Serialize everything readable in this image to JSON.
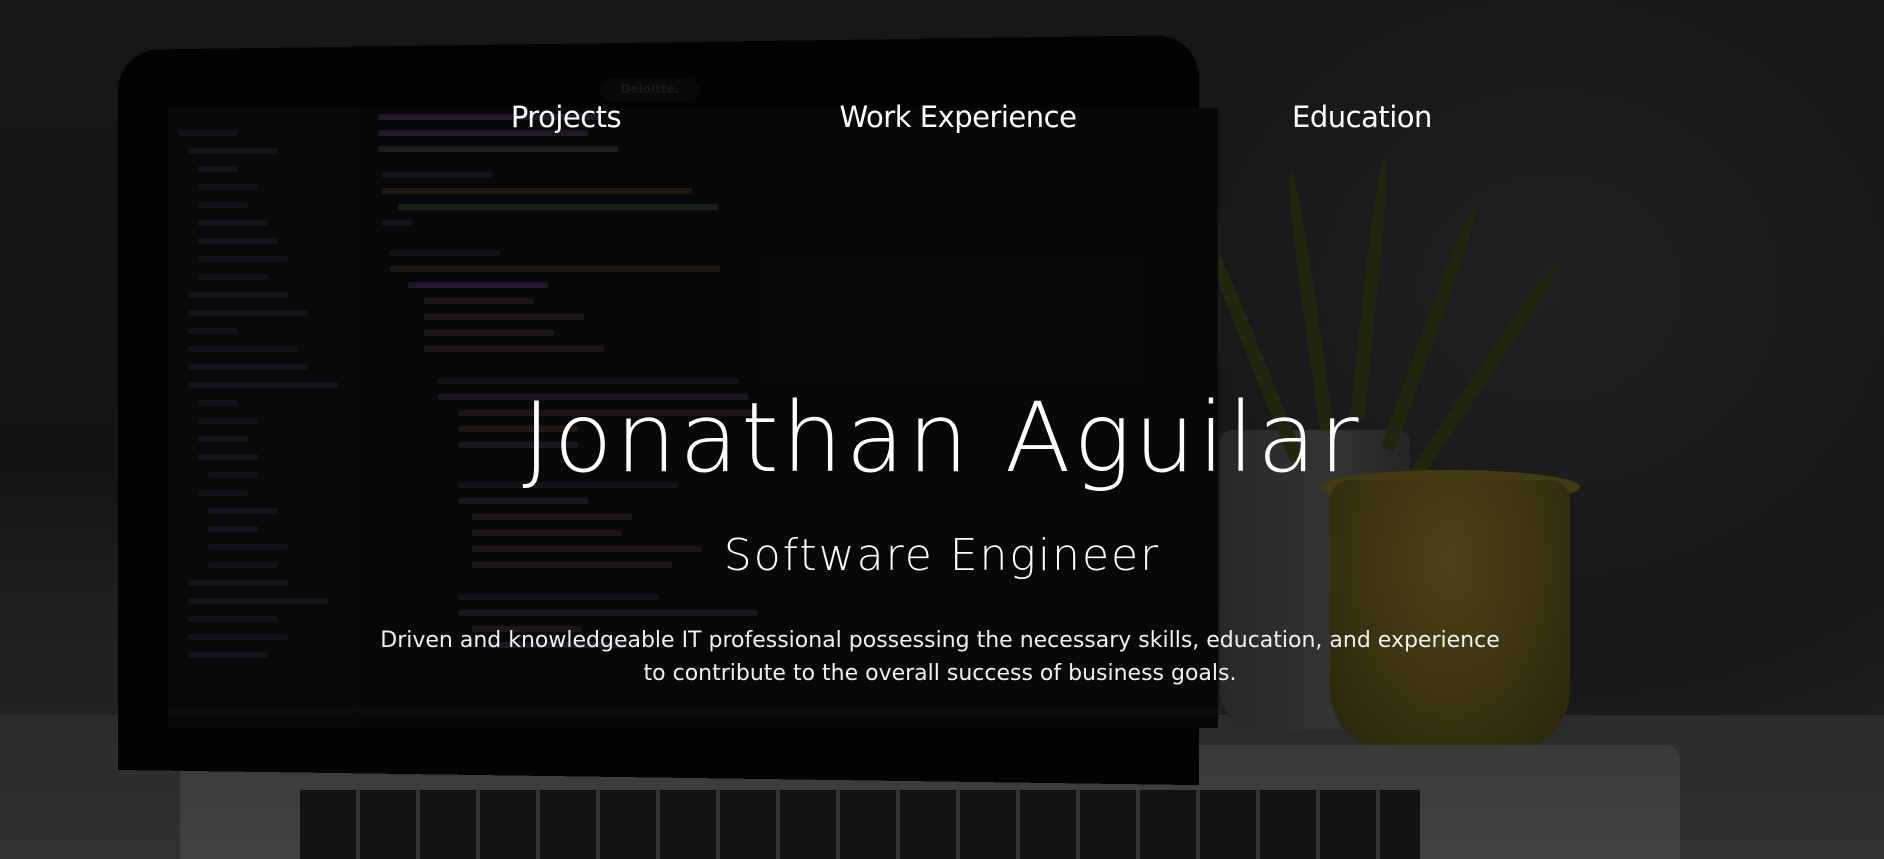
{
  "nav": {
    "projects": "Projects",
    "work_experience": "Work Experience",
    "education": "Education"
  },
  "hero": {
    "name": "Jonathan Aguilar",
    "title": "Software Engineer",
    "summary": "Driven and knowledgeable IT professional possessing the necessary skills, education, and experience to contribute to the overall success of business goals."
  },
  "background": {
    "laptop_brand": "Deloitte."
  },
  "colors": {
    "text": "#ffffff",
    "overlay": "#000000",
    "pot": "#7b6c22"
  }
}
